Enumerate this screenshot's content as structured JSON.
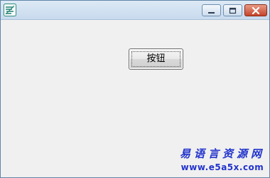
{
  "titlebar": {
    "app_icon": "easy-language-app-icon",
    "controls": {
      "minimize_icon": "minimize-icon",
      "maximize_icon": "maximize-icon",
      "close_icon": "close-icon"
    }
  },
  "client": {
    "button_label": "按钮"
  },
  "watermark": {
    "title": "易语言资源网",
    "url": "www.e5a5x.com"
  },
  "colors": {
    "close_button": "#c4432a",
    "watermark_text": "#2233cc",
    "client_background": "#f0f0f0"
  }
}
